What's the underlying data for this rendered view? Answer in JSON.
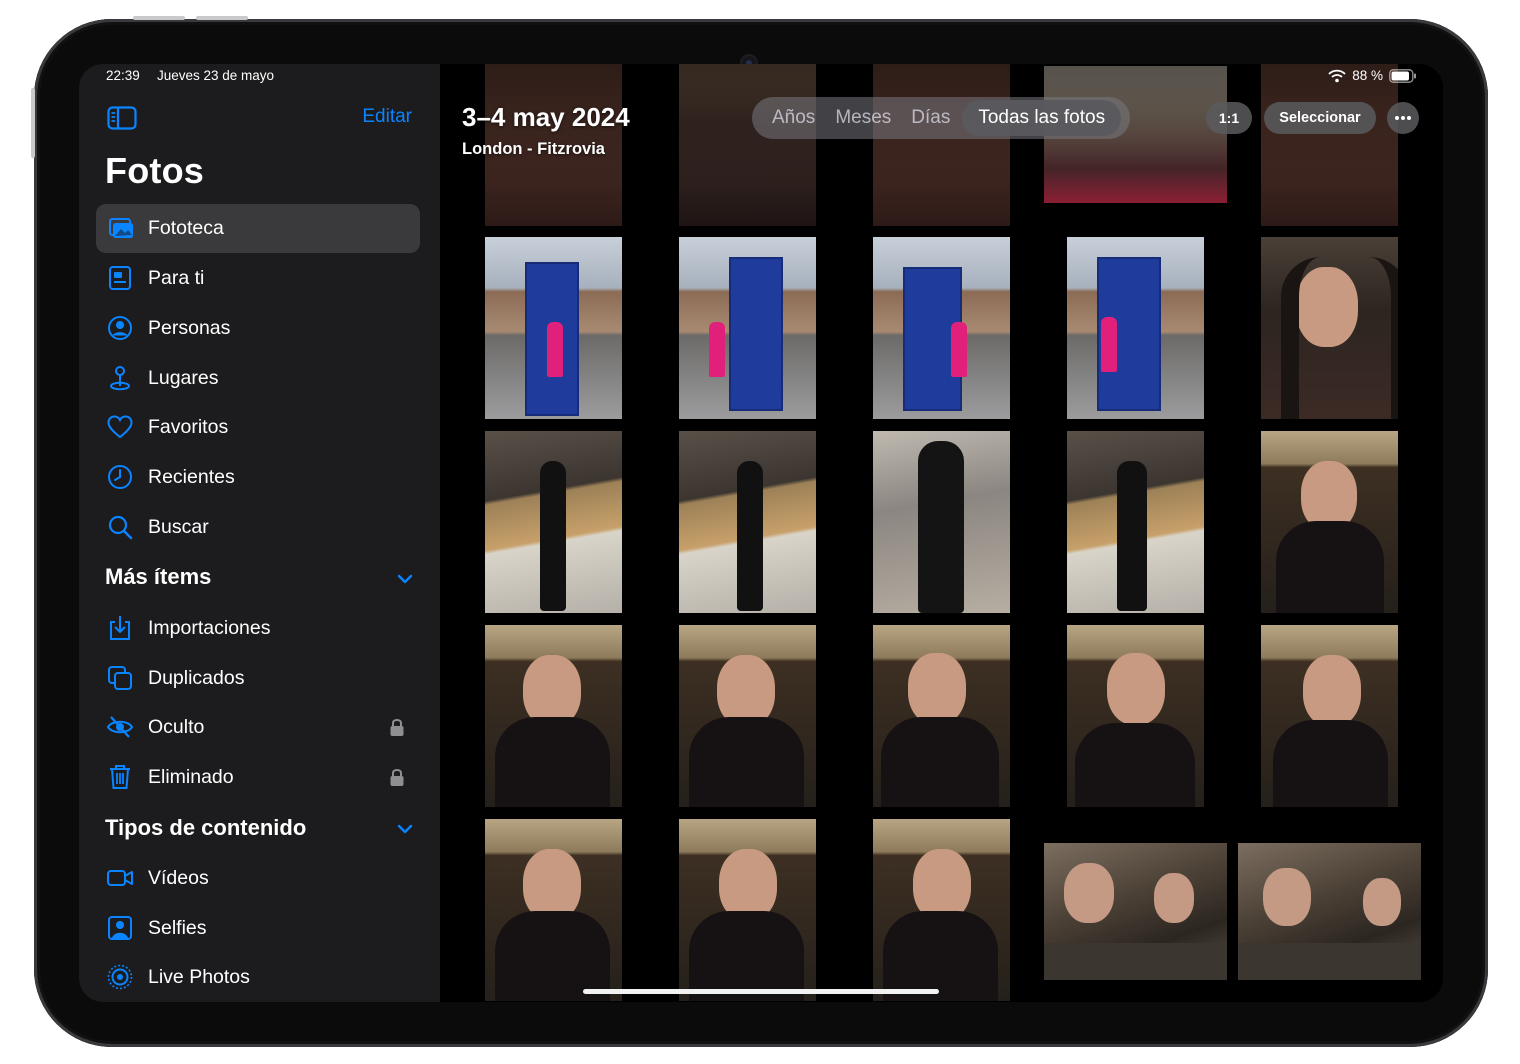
{
  "status_bar": {
    "time": "22:39",
    "date": "Jueves 23 de mayo",
    "battery": "88 %"
  },
  "sidebar": {
    "edit_label": "Editar",
    "title": "Fotos",
    "items": [
      {
        "label": "Fototeca",
        "icon": "photo-library-icon",
        "selected": true
      },
      {
        "label": "Para ti",
        "icon": "for-you-icon"
      },
      {
        "label": "Personas",
        "icon": "person-circle-icon"
      },
      {
        "label": "Lugares",
        "icon": "map-pin-icon"
      },
      {
        "label": "Favoritos",
        "icon": "heart-icon"
      },
      {
        "label": "Recientes",
        "icon": "clock-icon"
      },
      {
        "label": "Buscar",
        "icon": "search-icon"
      }
    ],
    "more_section": {
      "title": "Más ítems",
      "items": [
        {
          "label": "Importaciones",
          "icon": "import-icon"
        },
        {
          "label": "Duplicados",
          "icon": "duplicates-icon"
        },
        {
          "label": "Oculto",
          "icon": "eye-slash-icon",
          "locked": true
        },
        {
          "label": "Eliminado",
          "icon": "trash-icon",
          "locked": true
        }
      ]
    },
    "content_section": {
      "title": "Tipos de contenido",
      "items": [
        {
          "label": "Vídeos",
          "icon": "video-icon"
        },
        {
          "label": "Selfies",
          "icon": "selfie-icon"
        },
        {
          "label": "Live Photos",
          "icon": "live-photo-icon"
        }
      ]
    }
  },
  "main": {
    "date_title": "3–4 may 2024",
    "location": "London - Fitzrovia",
    "segments": [
      "Años",
      "Meses",
      "Días",
      "Todas las fotos"
    ],
    "active_segment": "Todas las fotos",
    "zoom_label": "1:1",
    "select_label": "Seleccionar"
  },
  "colors": {
    "accent": "#0a84ff",
    "sidebar_bg": "#1c1c1e",
    "selected_bg": "#3a3a3c"
  }
}
